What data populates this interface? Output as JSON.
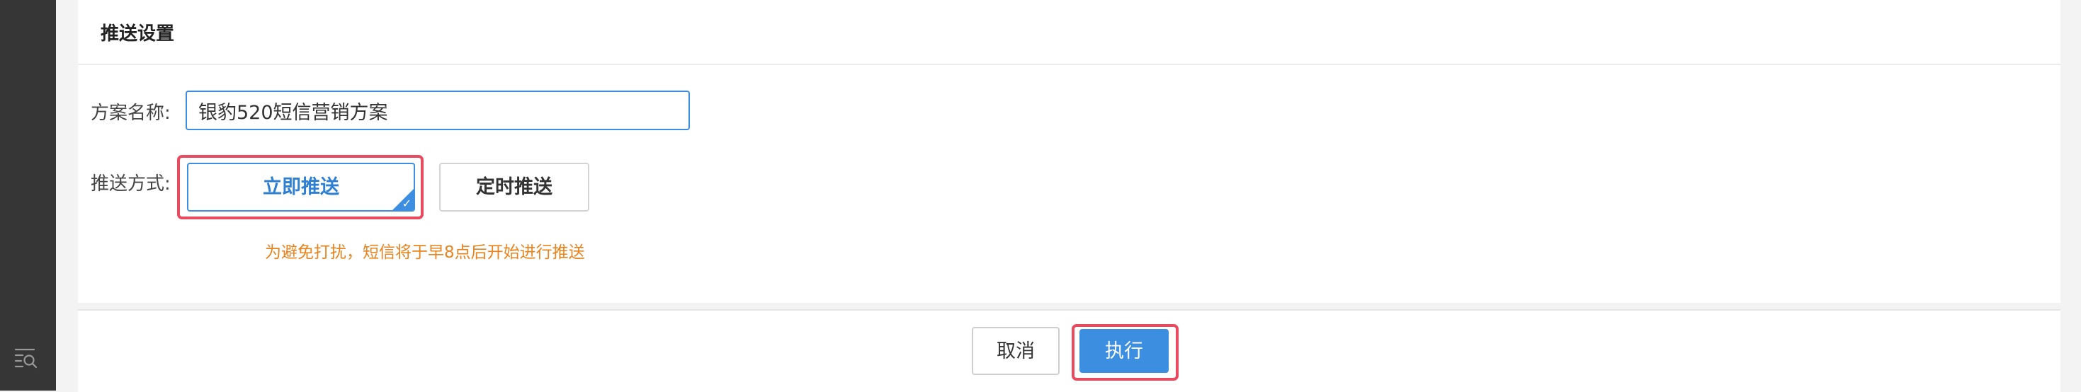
{
  "sidebar": {
    "bottom_icon": "search-list-icon"
  },
  "section": {
    "title": "推送设置"
  },
  "form": {
    "name_label": "方案名称:",
    "name_value": "银豹520短信营销方案",
    "mode_label": "推送方式:",
    "mode_options": [
      {
        "label": "立即推送",
        "selected": true
      },
      {
        "label": "定时推送",
        "selected": false
      }
    ],
    "hint": "为避免打扰，短信将于早8点后开始进行推送"
  },
  "footer": {
    "cancel_label": "取消",
    "execute_label": "执行"
  },
  "colors": {
    "accent": "#3c8fe0",
    "highlight": "#e84a5f",
    "hint": "#e9831e",
    "sidebar": "#363636"
  }
}
